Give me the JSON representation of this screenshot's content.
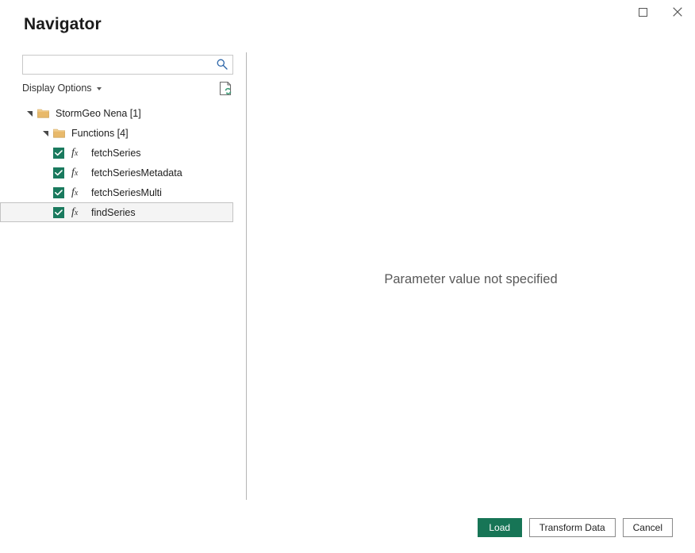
{
  "window": {
    "title": "Navigator",
    "controls": [
      {
        "name": "maximize-button",
        "icon": "maximize-icon"
      },
      {
        "name": "close-button",
        "icon": "close-icon"
      }
    ]
  },
  "search": {
    "value": "",
    "placeholder": "",
    "icon": "search-icon"
  },
  "display_options": {
    "label": "Display Options",
    "caret_icon": "chevron-down-icon",
    "refresh_icon": "refresh-document-icon"
  },
  "tree": {
    "items": [
      {
        "label": "StormGeo Nena [1]",
        "level": 0,
        "type": "folder",
        "expanded": true,
        "checked": null,
        "selected": false
      },
      {
        "label": "Functions [4]",
        "level": 1,
        "type": "folder",
        "expanded": true,
        "checked": null,
        "selected": false
      },
      {
        "label": "fetchSeries",
        "level": 2,
        "type": "function",
        "expanded": null,
        "checked": true,
        "selected": false
      },
      {
        "label": "fetchSeriesMetadata",
        "level": 2,
        "type": "function",
        "expanded": null,
        "checked": true,
        "selected": false
      },
      {
        "label": "fetchSeriesMulti",
        "level": 2,
        "type": "function",
        "expanded": null,
        "checked": true,
        "selected": false
      },
      {
        "label": "findSeries",
        "level": 2,
        "type": "function",
        "expanded": null,
        "checked": true,
        "selected": true
      }
    ]
  },
  "preview": {
    "message": "Parameter value not specified"
  },
  "footer": {
    "load_label": "Load",
    "transform_label": "Transform Data",
    "cancel_label": "Cancel"
  },
  "colors": {
    "accent_green": "#177556",
    "checkbox_green": "#1a7a5e",
    "folder_gold": "#e8b96a",
    "search_icon_blue": "#2a64a8",
    "divider_gray": "#b5b5b5",
    "message_gray": "#595959"
  }
}
